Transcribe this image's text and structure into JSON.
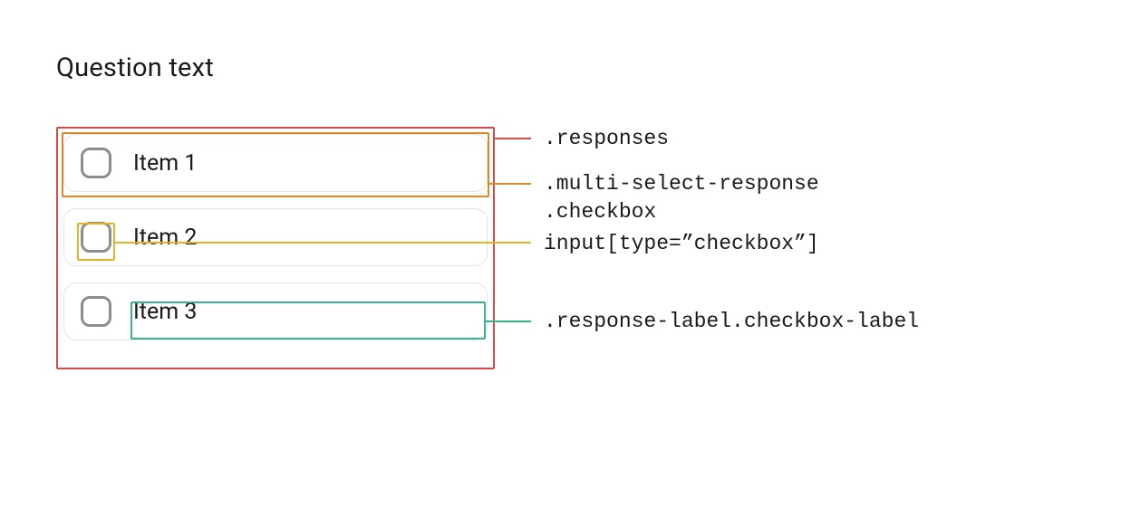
{
  "question": {
    "title": "Question text"
  },
  "responses": {
    "items": [
      {
        "label": "Item 1"
      },
      {
        "label": "Item 2"
      },
      {
        "label": "Item 3"
      }
    ]
  },
  "annotations": {
    "responses": ".responses",
    "row": ".multi-select-response\n.checkbox",
    "checkbox": "input[type=”checkbox”]",
    "label": ".response-label.checkbox-label"
  },
  "colors": {
    "responses": "#d04d4b",
    "row": "#d88a2a",
    "checkbox": "#e3b327",
    "label": "#3bb08f"
  }
}
